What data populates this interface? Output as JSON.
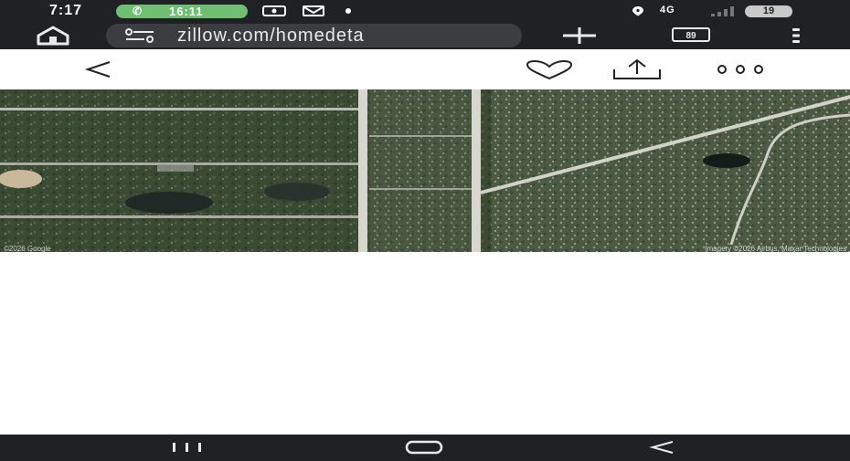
{
  "status_bar": {
    "time": "7:17",
    "call_timer": "16:11",
    "network": "4G",
    "battery": "19",
    "icons": [
      "phone-icon",
      "screenshot-icon",
      "gmail-icon",
      "dot-icon",
      "location-icon",
      "signal-icon"
    ]
  },
  "browser": {
    "url": "zillow.com/homedeta",
    "tab_count": "89",
    "icons": [
      "home-icon",
      "site-info-icon",
      "new-tab-icon",
      "tabs-icon",
      "menu-icon"
    ]
  },
  "page_header": {
    "icons": [
      "back-arrow-icon",
      "heart-icon",
      "share-icon",
      "more-icon"
    ]
  },
  "map": {
    "attribution_left": "©2026 Google",
    "attribution_right": "Imagery ©2026 Airbus, Maxar Technologies"
  },
  "nav_bar": {
    "icons": [
      "recents-icon",
      "home-nav-icon",
      "back-nav-icon"
    ]
  },
  "colors": {
    "system_bar": "#202124",
    "url_field": "#3c3d40",
    "call_pill": "#6fbf73",
    "page_background": "#ffffff"
  }
}
